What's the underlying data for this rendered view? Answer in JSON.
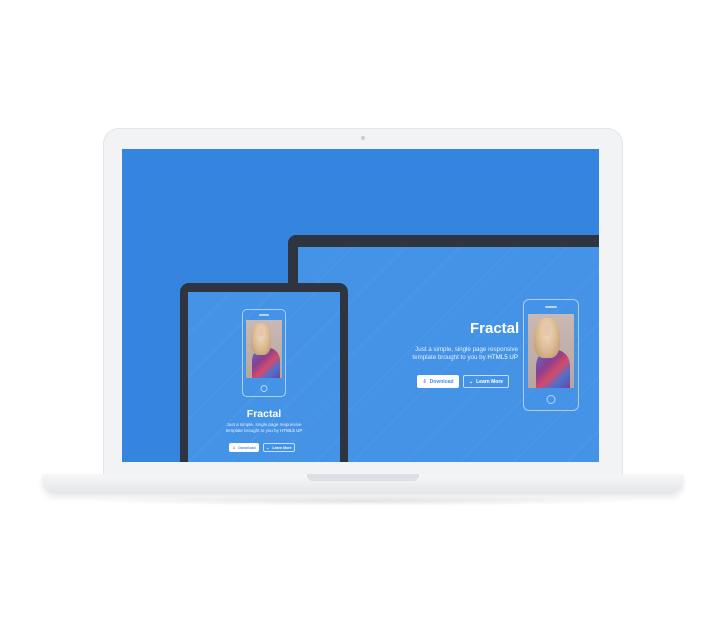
{
  "desktop": {
    "title": "Fractal",
    "tagline_line1": "Just a simple, single page responsive",
    "tagline_line2_prefix": "template brought to you by ",
    "tagline_link": "HTML5 UP",
    "primary_button": {
      "label": "Download",
      "icon": "download-icon"
    },
    "secondary_button": {
      "label": "Learn More",
      "icon": "chevron-down-icon"
    }
  },
  "tablet": {
    "title": "Fractal",
    "tagline_line1": "Just a simple, single page responsive",
    "tagline_line2_prefix": "template brought to you by ",
    "tagline_link": "HTML5 UP",
    "primary_button": {
      "label": "Download",
      "icon": "download-icon"
    },
    "secondary_button": {
      "label": "Learn More",
      "icon": "chevron-down-icon"
    }
  },
  "colors": {
    "screen_background": "#3584dd",
    "banner_background": "#4593e6",
    "device_bezel": "#2e3440",
    "laptop_shell": "#f2f3f5"
  }
}
